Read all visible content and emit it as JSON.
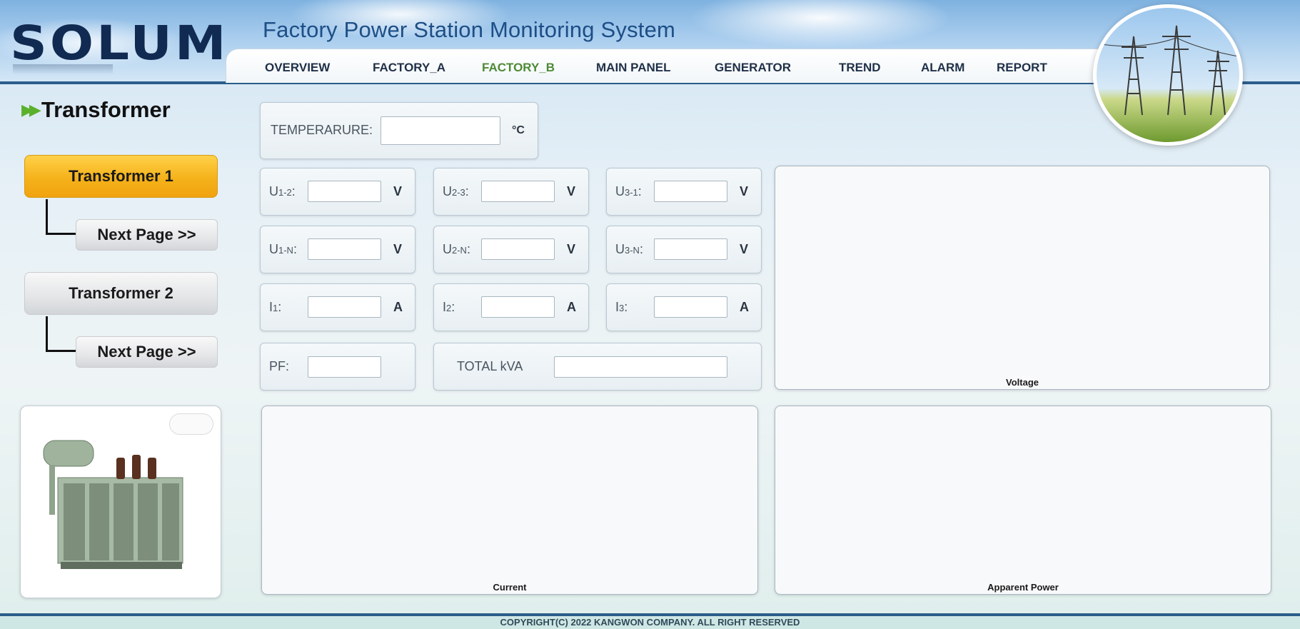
{
  "header": {
    "logo": "SOLUM",
    "title": "Factory Power Station Monitoring System"
  },
  "nav": {
    "items": [
      {
        "label": "OVERVIEW"
      },
      {
        "label": "FACTORY_A"
      },
      {
        "label": "FACTORY_B",
        "active": true
      },
      {
        "label": "MAIN PANEL"
      },
      {
        "label": "GENERATOR"
      },
      {
        "label": "TREND"
      },
      {
        "label": "ALARM"
      },
      {
        "label": "REPORT"
      }
    ],
    "active_color": "#4d8a35"
  },
  "sidebar": {
    "section_title": "Transformer",
    "transformers": [
      {
        "label": "Transformer 1",
        "active": true,
        "next": "Next Page >>"
      },
      {
        "label": "Transformer 2",
        "active": false,
        "next": "Next Page >>"
      }
    ]
  },
  "readings": {
    "temperature": {
      "label": "TEMPERARURE:",
      "unit": "°C",
      "value": ""
    },
    "voltage_ll": [
      {
        "label": "U",
        "sub": "1-2",
        "unit": "V",
        "value": ""
      },
      {
        "label": "U",
        "sub": "2-3",
        "unit": "V",
        "value": ""
      },
      {
        "label": "U",
        "sub": "3-1",
        "unit": "V",
        "value": ""
      }
    ],
    "voltage_ln": [
      {
        "label": "U",
        "sub": "1-N",
        "unit": "V",
        "value": ""
      },
      {
        "label": "U",
        "sub": "2-N",
        "unit": "V",
        "value": ""
      },
      {
        "label": "U",
        "sub": "3-N",
        "unit": "V",
        "value": ""
      }
    ],
    "current": [
      {
        "label": "I",
        "sub": "1",
        "unit": "A",
        "value": ""
      },
      {
        "label": "I",
        "sub": "2",
        "unit": "A",
        "value": ""
      },
      {
        "label": "I",
        "sub": "3",
        "unit": "A",
        "value": ""
      }
    ],
    "pf": {
      "label": "PF:",
      "value": ""
    },
    "total_kva": {
      "label": "TOTAL kVA",
      "value": ""
    }
  },
  "charts": {
    "voltage": "Voltage",
    "current": "Current",
    "apparent_power": "Apparent Power"
  },
  "footer": {
    "copyright": "COPYRIGHT(C) 2022 KANGWON COMPANY. ALL RIGHT RESERVED"
  },
  "colors": {
    "brand_dark": "#102a52",
    "accent_line": "#2c5d8a",
    "active_button": "#f5b21a"
  }
}
